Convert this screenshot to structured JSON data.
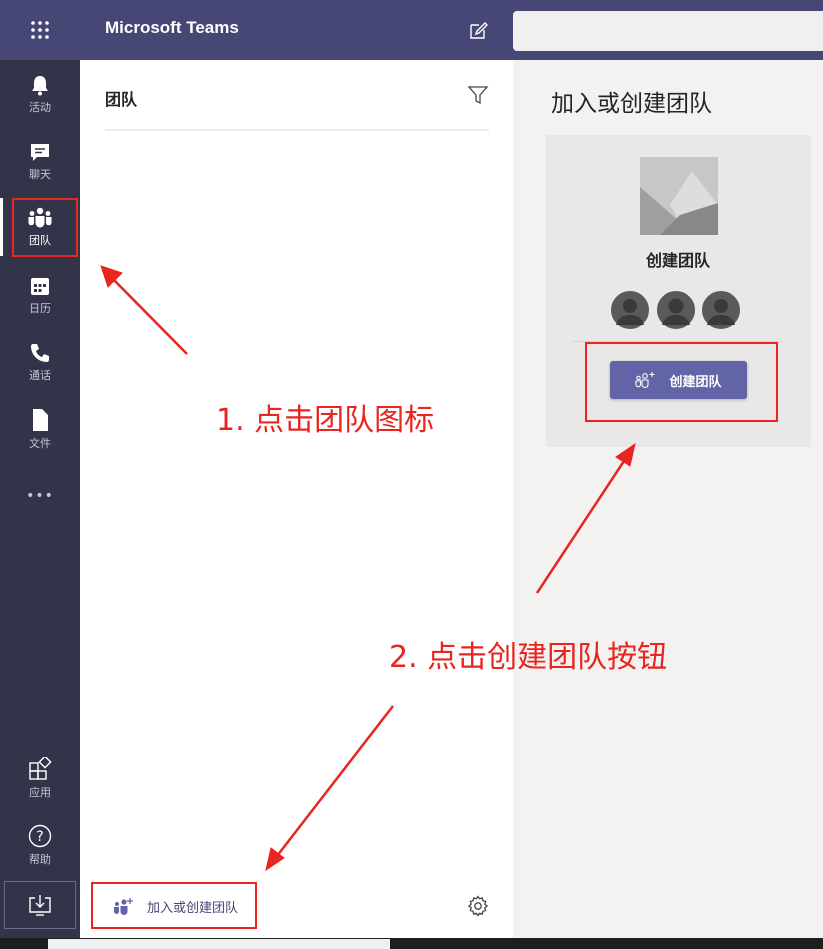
{
  "header": {
    "app_title": "Microsoft Teams",
    "search_placeholder": ""
  },
  "rail": {
    "items": [
      {
        "label": "活动",
        "icon": "bell-icon"
      },
      {
        "label": "聊天",
        "icon": "chat-icon"
      },
      {
        "label": "团队",
        "icon": "teams-icon",
        "active": true
      },
      {
        "label": "日历",
        "icon": "calendar-icon"
      },
      {
        "label": "通话",
        "icon": "phone-icon"
      },
      {
        "label": "文件",
        "icon": "file-icon"
      }
    ],
    "more": "•••",
    "apps_label": "应用",
    "help_label": "帮助"
  },
  "teams_panel": {
    "title": "团队",
    "join_create_label": "加入或创建团队"
  },
  "right_pane": {
    "title": "加入或创建团队",
    "card_title": "创建团队",
    "create_button_label": "创建团队"
  },
  "annotations": {
    "step1": "1. 点击团队图标",
    "step2": "2. 点击创建团队按钮"
  },
  "colors": {
    "brand": "#464775",
    "rail": "#33344a",
    "accent": "#6264a7",
    "annotation": "#e8251f"
  }
}
